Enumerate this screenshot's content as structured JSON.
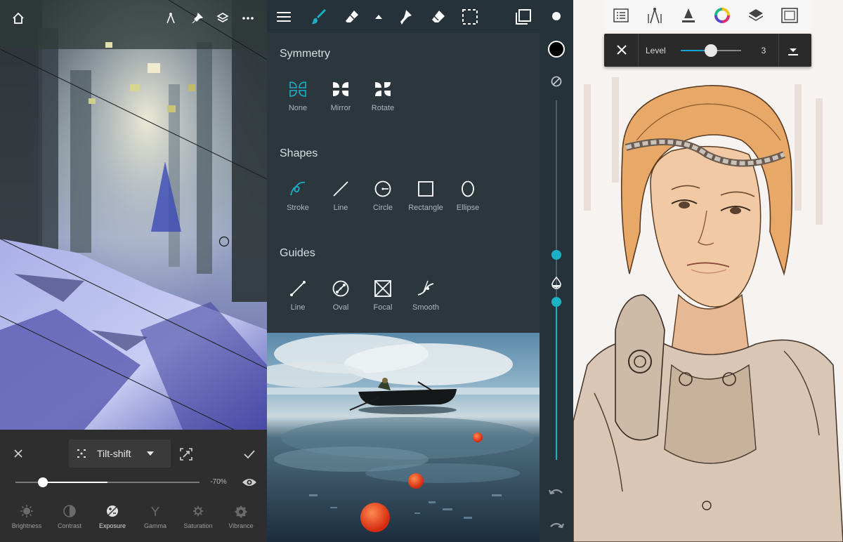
{
  "panel_left": {
    "top_icons": [
      "home-icon",
      "ruler-icon",
      "pin-icon",
      "layers-icon",
      "more-icon"
    ],
    "filter": {
      "selected": "Tilt-shift",
      "value_label": "-70%",
      "value": -0.7
    },
    "adjustments": [
      {
        "label": "Brightness",
        "icon": "brightness-icon"
      },
      {
        "label": "Contrast",
        "icon": "contrast-icon"
      },
      {
        "label": "Exposure",
        "icon": "exposure-icon"
      },
      {
        "label": "Gamma",
        "icon": "gamma-icon"
      },
      {
        "label": "Saturation",
        "icon": "saturation-icon"
      },
      {
        "label": "Vibrance",
        "icon": "vibrance-icon"
      }
    ]
  },
  "panel_middle": {
    "toolbar": [
      "menu-icon",
      "brush-icon",
      "eraser-icon",
      "chevron-up-icon",
      "smudge-icon",
      "fill-icon",
      "selection-icon",
      "copy-icon"
    ],
    "symmetry": {
      "title": "Symmetry",
      "items": [
        "None",
        "Mirror",
        "Rotate"
      ]
    },
    "shapes": {
      "title": "Shapes",
      "items": [
        "Stroke",
        "Line",
        "Circle",
        "Rectangle",
        "Ellipse"
      ]
    },
    "guides": {
      "title": "Guides",
      "items": [
        "Line",
        "Oval",
        "Focal",
        "Smooth"
      ]
    },
    "rail": {
      "brush_color": "#000000",
      "accent": "#1ab1c6",
      "size_level": 0.43,
      "opacity_level": 0.44
    }
  },
  "panel_right": {
    "toolbar": [
      "list-icon",
      "ruler-guides-icon",
      "fill-bucket-icon",
      "color-wheel-icon",
      "layers-icon",
      "fullscreen-icon"
    ],
    "level": {
      "label": "Level",
      "value": "3",
      "slider_fraction": 0.5
    }
  }
}
